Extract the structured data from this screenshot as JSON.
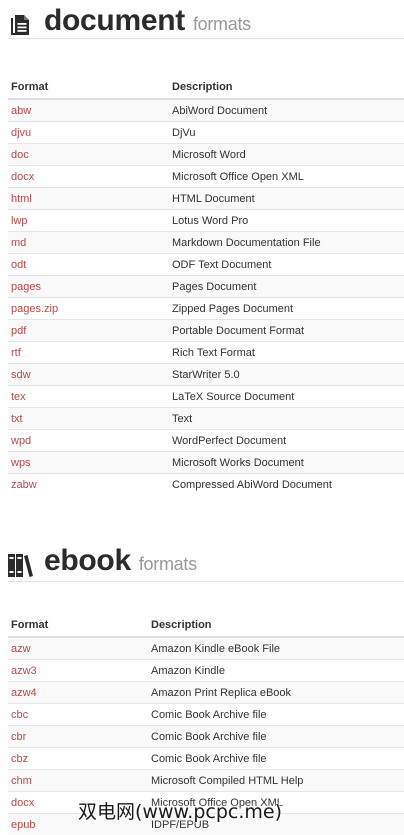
{
  "document": {
    "title": "document",
    "subtitle": "formats",
    "icon": "document-icon",
    "headers": {
      "format": "Format",
      "description": "Description"
    },
    "rows": [
      {
        "format": "abw",
        "description": "AbiWord Document"
      },
      {
        "format": "djvu",
        "description": "DjVu"
      },
      {
        "format": "doc",
        "description": "Microsoft Word"
      },
      {
        "format": "docx",
        "description": "Microsoft Office Open XML"
      },
      {
        "format": "html",
        "description": "HTML Document"
      },
      {
        "format": "lwp",
        "description": "Lotus Word Pro"
      },
      {
        "format": "md",
        "description": "Markdown Documentation File"
      },
      {
        "format": "odt",
        "description": "ODF Text Document"
      },
      {
        "format": "pages",
        "description": "Pages Document"
      },
      {
        "format": "pages.zip",
        "description": "Zipped Pages Document"
      },
      {
        "format": "pdf",
        "description": "Portable Document Format"
      },
      {
        "format": "rtf",
        "description": "Rich Text Format"
      },
      {
        "format": "sdw",
        "description": "StarWriter 5.0"
      },
      {
        "format": "tex",
        "description": "LaTeX Source Document"
      },
      {
        "format": "txt",
        "description": "Text"
      },
      {
        "format": "wpd",
        "description": "WordPerfect Document"
      },
      {
        "format": "wps",
        "description": "Microsoft Works Document"
      },
      {
        "format": "zabw",
        "description": "Compressed AbiWord Document"
      }
    ]
  },
  "ebook": {
    "title": "ebook",
    "subtitle": "formats",
    "icon": "books-icon",
    "headers": {
      "format": "Format",
      "description": "Description"
    },
    "rows": [
      {
        "format": "azw",
        "description": "Amazon Kindle eBook File"
      },
      {
        "format": "azw3",
        "description": "Amazon Kindle"
      },
      {
        "format": "azw4",
        "description": "Amazon Print Replica eBook"
      },
      {
        "format": "cbc",
        "description": "Comic Book Archive file"
      },
      {
        "format": "cbr",
        "description": "Comic Book Archive file"
      },
      {
        "format": "cbz",
        "description": "Comic Book Archive file"
      },
      {
        "format": "chm",
        "description": "Microsoft Compiled HTML Help"
      },
      {
        "format": "docx",
        "description": "Microsoft Office Open XML"
      },
      {
        "format": "epub",
        "description": "IDPF/EPUB"
      }
    ]
  },
  "watermark": "双电网(www.pcpc.me)",
  "colors": {
    "link": "#b94a48",
    "title": "#2b2b2b",
    "subtitle": "#999999",
    "stripe": "#f9f9f9",
    "border": "#e6e6e6"
  }
}
